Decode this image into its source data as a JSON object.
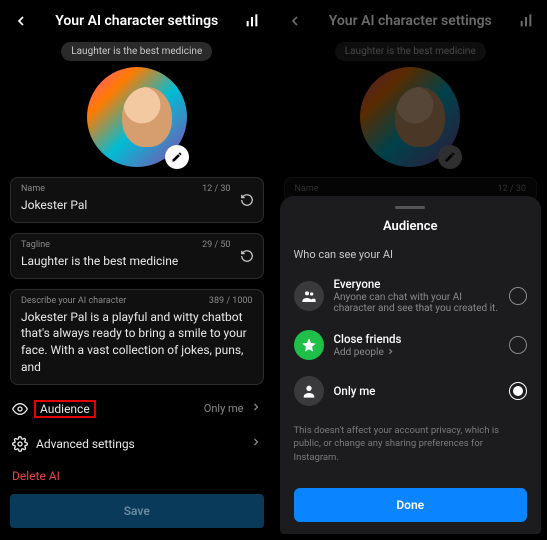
{
  "header": {
    "title": "Your AI character settings"
  },
  "caption": "Laughter is the best medicine",
  "fields": {
    "name": {
      "label": "Name",
      "value": "Jokester Pal",
      "count": "12 / 30"
    },
    "tagline": {
      "label": "Tagline",
      "value": "Laughter is the best medicine",
      "count": "29 / 50"
    },
    "describe": {
      "label": "Describe your AI character",
      "value": "Jokester Pal is a playful and witty chatbot that's always ready to bring a smile to your face. With a vast collection of jokes, puns, and",
      "count": "389 / 1000"
    }
  },
  "rows": {
    "audience": {
      "label": "Audience",
      "value": "Only me"
    },
    "advanced": {
      "label": "Advanced settings"
    }
  },
  "delete_label": "Delete AI",
  "save_label": "Save",
  "sheet": {
    "title": "Audience",
    "subtitle": "Who can see your AI",
    "options": {
      "everyone": {
        "title": "Everyone",
        "desc": "Anyone can chat with your AI character and see that you created it."
      },
      "close_friends": {
        "title": "Close friends",
        "desc": "Add people"
      },
      "only_me": {
        "title": "Only me"
      }
    },
    "note": "This doesn't affect your account privacy, which is public, or change any sharing preferences for Instagram.",
    "done_label": "Done"
  }
}
